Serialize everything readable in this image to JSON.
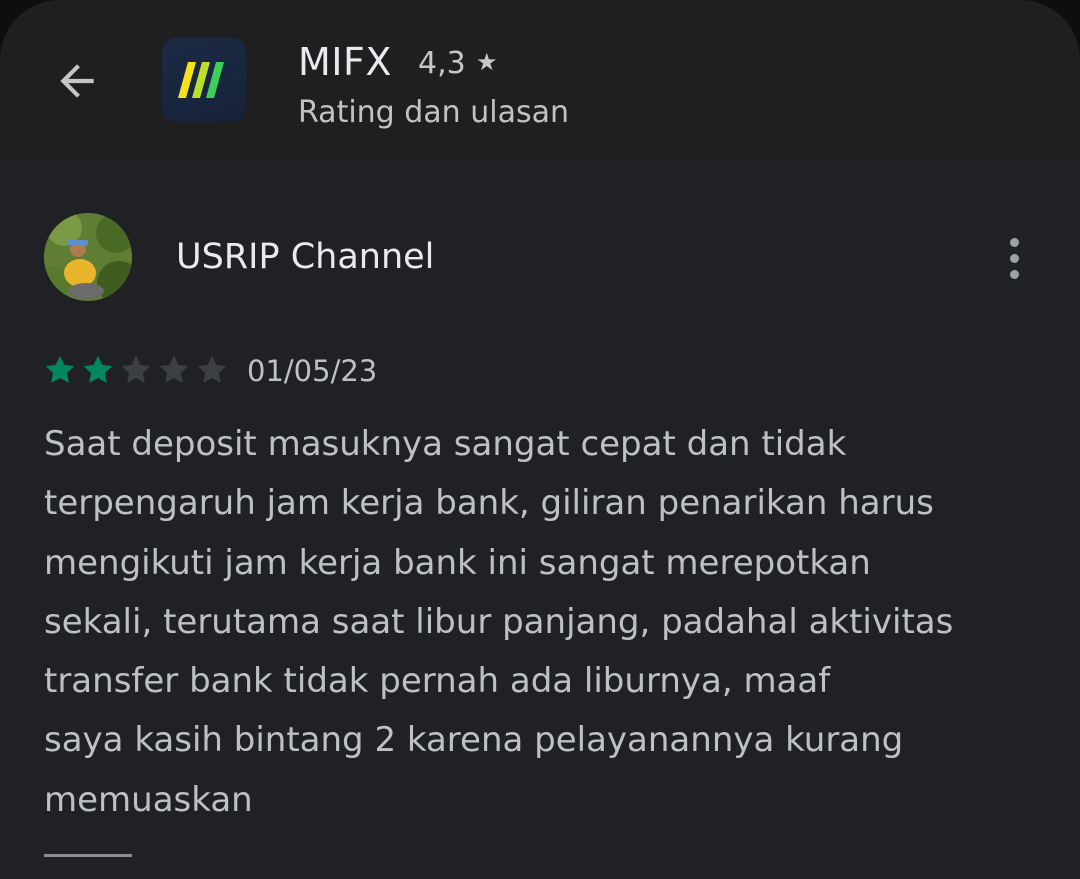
{
  "header": {
    "app_name": "MIFX",
    "rating": "4,3",
    "subtitle": "Rating dan ulasan",
    "icons": {
      "back": "arrow-back-icon",
      "app": "mifx-app-icon",
      "rating_star": "star-icon"
    }
  },
  "review": {
    "reviewer": "USRIP Channel",
    "rating_value": 2,
    "rating_max": 5,
    "date": "01/05/23",
    "text": "Saat deposit masuknya sangat cepat dan tidak\nterpengaruh jam kerja bank, giliran penarikan harus\nmengikuti jam kerja bank ini sangat merepotkan\nsekali, terutama saat libur panjang, padahal aktivitas\ntransfer bank tidak pernah ada liburnya, maaf\nsaya kasih bintang 2 karena pelayanannya kurang\nmemuaskan",
    "icons": {
      "more": "more-vert-icon"
    }
  },
  "colors": {
    "background": "#202124",
    "text_primary": "#e8eaed",
    "text_secondary": "#bdc1c6",
    "star_filled": "#01875f",
    "star_empty": "#3c4043",
    "app_icon_bg": "#1c2a44",
    "app_icon_yellow": "#f5e21b",
    "app_icon_green": "#3ccf5a"
  }
}
